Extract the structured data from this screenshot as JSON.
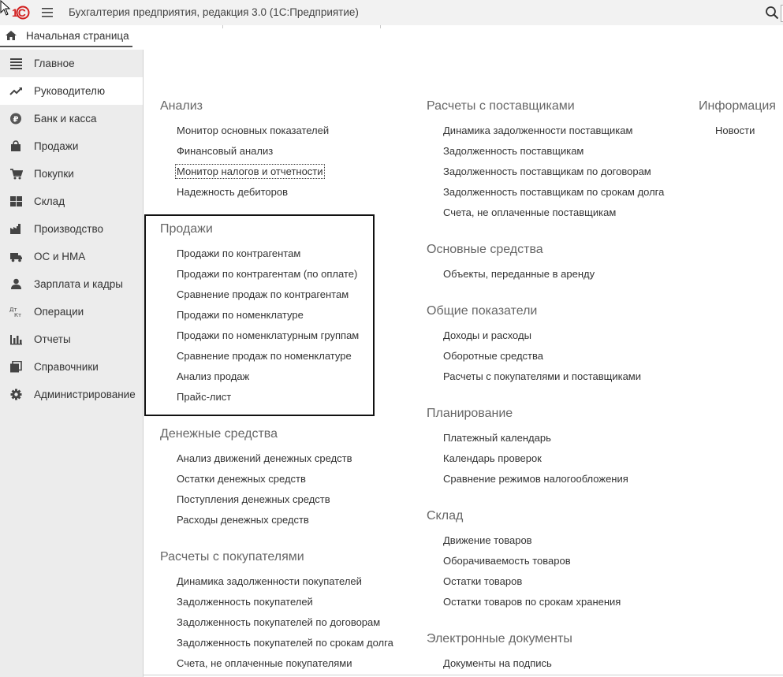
{
  "titlebar": {
    "logo": "1C",
    "title": "Бухгалтерия предприятия, редакция 3.0  (1С:Предприятие)"
  },
  "tabs": {
    "home_label": "Начальная страница"
  },
  "sidebar": {
    "items": [
      {
        "label": "Главное",
        "icon": "list-icon"
      },
      {
        "label": "Руководителю",
        "icon": "trend-icon"
      },
      {
        "label": "Банк и касса",
        "icon": "ruble-coin-icon"
      },
      {
        "label": "Продажи",
        "icon": "shopping-bag-icon"
      },
      {
        "label": "Покупки",
        "icon": "cart-icon"
      },
      {
        "label": "Склад",
        "icon": "warehouse-grid-icon"
      },
      {
        "label": "Производство",
        "icon": "factory-icon"
      },
      {
        "label": "ОС и НМА",
        "icon": "truck-icon"
      },
      {
        "label": "Зарплата и кадры",
        "icon": "person-icon"
      },
      {
        "label": "Операции",
        "icon": "debit-credit-icon"
      },
      {
        "label": "Отчеты",
        "icon": "bar-chart-icon"
      },
      {
        "label": "Справочники",
        "icon": "books-icon"
      },
      {
        "label": "Администрирование",
        "icon": "gear-icon"
      }
    ],
    "active_index": 1
  },
  "content": {
    "col1": [
      {
        "title": "Анализ",
        "links": [
          "Монитор основных показателей",
          "Финансовый анализ",
          "Монитор налогов и отчетности",
          "Надежность дебиторов"
        ]
      },
      {
        "title": "Продажи",
        "links": [
          "Продажи по контрагентам",
          "Продажи по контрагентам (по оплате)",
          "Сравнение продаж по контрагентам",
          "Продажи по номенклатуре",
          "Продажи по номенклатурным группам",
          "Сравнение продаж по номенклатуре",
          "Анализ продаж",
          "Прайс-лист"
        ]
      },
      {
        "title": "Денежные средства",
        "links": [
          "Анализ движений денежных средств",
          "Остатки денежных средств",
          "Поступления денежных средств",
          "Расходы денежных средств"
        ]
      },
      {
        "title": "Расчеты с покупателями",
        "links": [
          "Динамика задолженности покупателей",
          "Задолженность покупателей",
          "Задолженность покупателей по договорам",
          "Задолженность покупателей по срокам долга",
          "Счета, не оплаченные покупателями"
        ]
      }
    ],
    "col2": [
      {
        "title": "Расчеты с поставщиками",
        "links": [
          "Динамика задолженности поставщикам",
          "Задолженность поставщикам",
          "Задолженность поставщикам по договорам",
          "Задолженность поставщикам по срокам долга",
          "Счета, не оплаченные поставщикам"
        ]
      },
      {
        "title": "Основные средства",
        "links": [
          "Объекты, переданные в аренду"
        ]
      },
      {
        "title": "Общие показатели",
        "links": [
          "Доходы и расходы",
          "Оборотные средства",
          "Расчеты с покупателями и поставщиками"
        ]
      },
      {
        "title": "Планирование",
        "links": [
          "Платежный календарь",
          "Календарь проверок",
          "Сравнение режимов налогообложения"
        ]
      },
      {
        "title": "Склад",
        "links": [
          "Движение товаров",
          "Оборачиваемость товаров",
          "Остатки товаров",
          "Остатки товаров по срокам хранения"
        ]
      },
      {
        "title": "Электронные документы",
        "links": [
          "Документы на подпись"
        ]
      }
    ],
    "col3": [
      {
        "title": "Информация",
        "links": [
          "Новости"
        ]
      }
    ]
  },
  "colors": {
    "sidebar_bg": "#ececec",
    "active_bg": "#ffffff",
    "section_title": "#666666",
    "link_text": "#333333",
    "logo_red": "#d21f1f"
  }
}
